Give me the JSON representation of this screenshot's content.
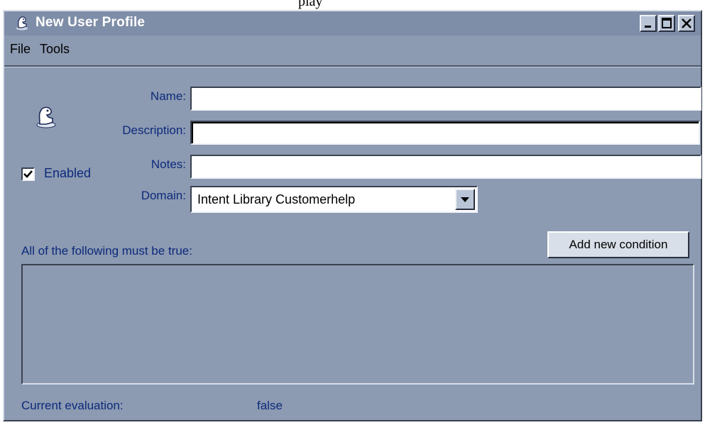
{
  "window": {
    "title": "New User Profile",
    "title_icon": "user-profile-icon",
    "controls": [
      "minimize-icon",
      "maximize-icon",
      "close-icon"
    ]
  },
  "top_strip_text": "play",
  "menu": {
    "items": [
      {
        "label": "File"
      },
      {
        "label": "Tools"
      }
    ]
  },
  "form": {
    "profile_icon": "user-profile-icon",
    "name_label": "Name:",
    "name_value": "",
    "description_label": "Description:",
    "description_value": "",
    "notes_label": "Notes:",
    "notes_value": "",
    "domain_label": "Domain:",
    "domain_value": "Intent Library Customerhelp",
    "enabled_label": "Enabled",
    "enabled_checked": true
  },
  "conditions": {
    "header": "All of the following must be true:",
    "add_button_label": "Add new condition",
    "items": []
  },
  "evaluation": {
    "label": "Current evaluation:",
    "value": "false"
  },
  "colors": {
    "window_bg": "#8c9ab2",
    "titlebar_bg": "#7f8ea8",
    "label_text": "#0d2a7a",
    "field_bg": "#ffffff"
  }
}
